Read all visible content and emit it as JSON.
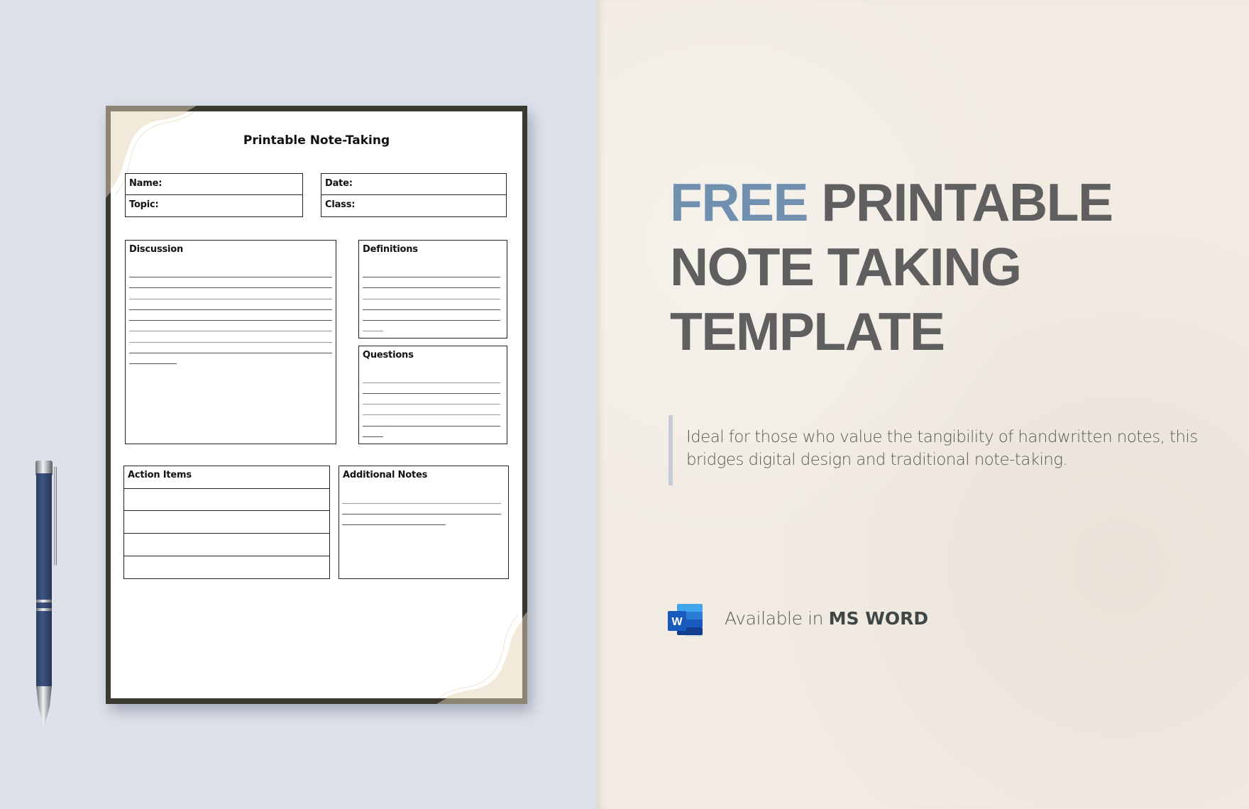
{
  "document": {
    "title": "Printable Note-Taking",
    "fields": {
      "name": "Name:",
      "date": "Date:",
      "topic": "Topic:",
      "class": "Class:"
    },
    "sections": {
      "discussion": "Discussion",
      "definitions": "Definitions",
      "questions": "Questions",
      "action_items": "Action Items",
      "additional_notes": "Additional Notes"
    },
    "colors": {
      "frame": "#393932",
      "corner_accent": "#f3e9da",
      "corner_shade": "#8e8474"
    }
  },
  "promo": {
    "headline_accent": "FREE",
    "headline_line1_rest": "PRINTABLE",
    "headline_line2": "NOTE TAKING",
    "headline_line3": "TEMPLATE",
    "description": "Ideal for those who value the tangibility of handwritten notes, this bridges digital design and traditional note-taking.",
    "availability_prefix": "Available in",
    "availability_app": "MS WORD",
    "app_icon": "microsoft-word-icon",
    "colors": {
      "accent": "#7190b0",
      "headline": "#5f5f5f",
      "left_background": "#dde1ea",
      "right_background": "#f1ebe2"
    }
  },
  "decor": {
    "pen_icon": "ballpoint-pen"
  }
}
